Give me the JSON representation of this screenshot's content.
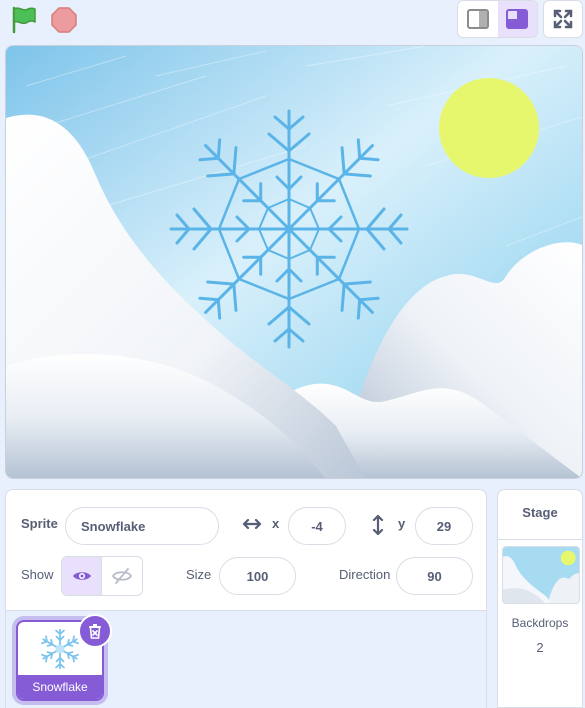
{
  "controls": {
    "green_flag_color": "#4cbf56",
    "stop_color": "#ec9c9c"
  },
  "sprite_info": {
    "sprite_label": "Sprite",
    "sprite_name": "Snowflake",
    "x_label": "x",
    "x_value": "-4",
    "y_label": "y",
    "y_value": "29",
    "show_label": "Show",
    "size_label": "Size",
    "size_value": "100",
    "direction_label": "Direction",
    "direction_value": "90"
  },
  "sprites": [
    {
      "name": "Snowflake"
    }
  ],
  "stage_panel": {
    "title": "Stage",
    "backdrops_label": "Backdrops",
    "backdrops_count": "2"
  },
  "colors": {
    "accent": "#855cd6",
    "text": "#575e75",
    "sun": "#e6f76e",
    "snowflake": "#5ab4e8"
  }
}
